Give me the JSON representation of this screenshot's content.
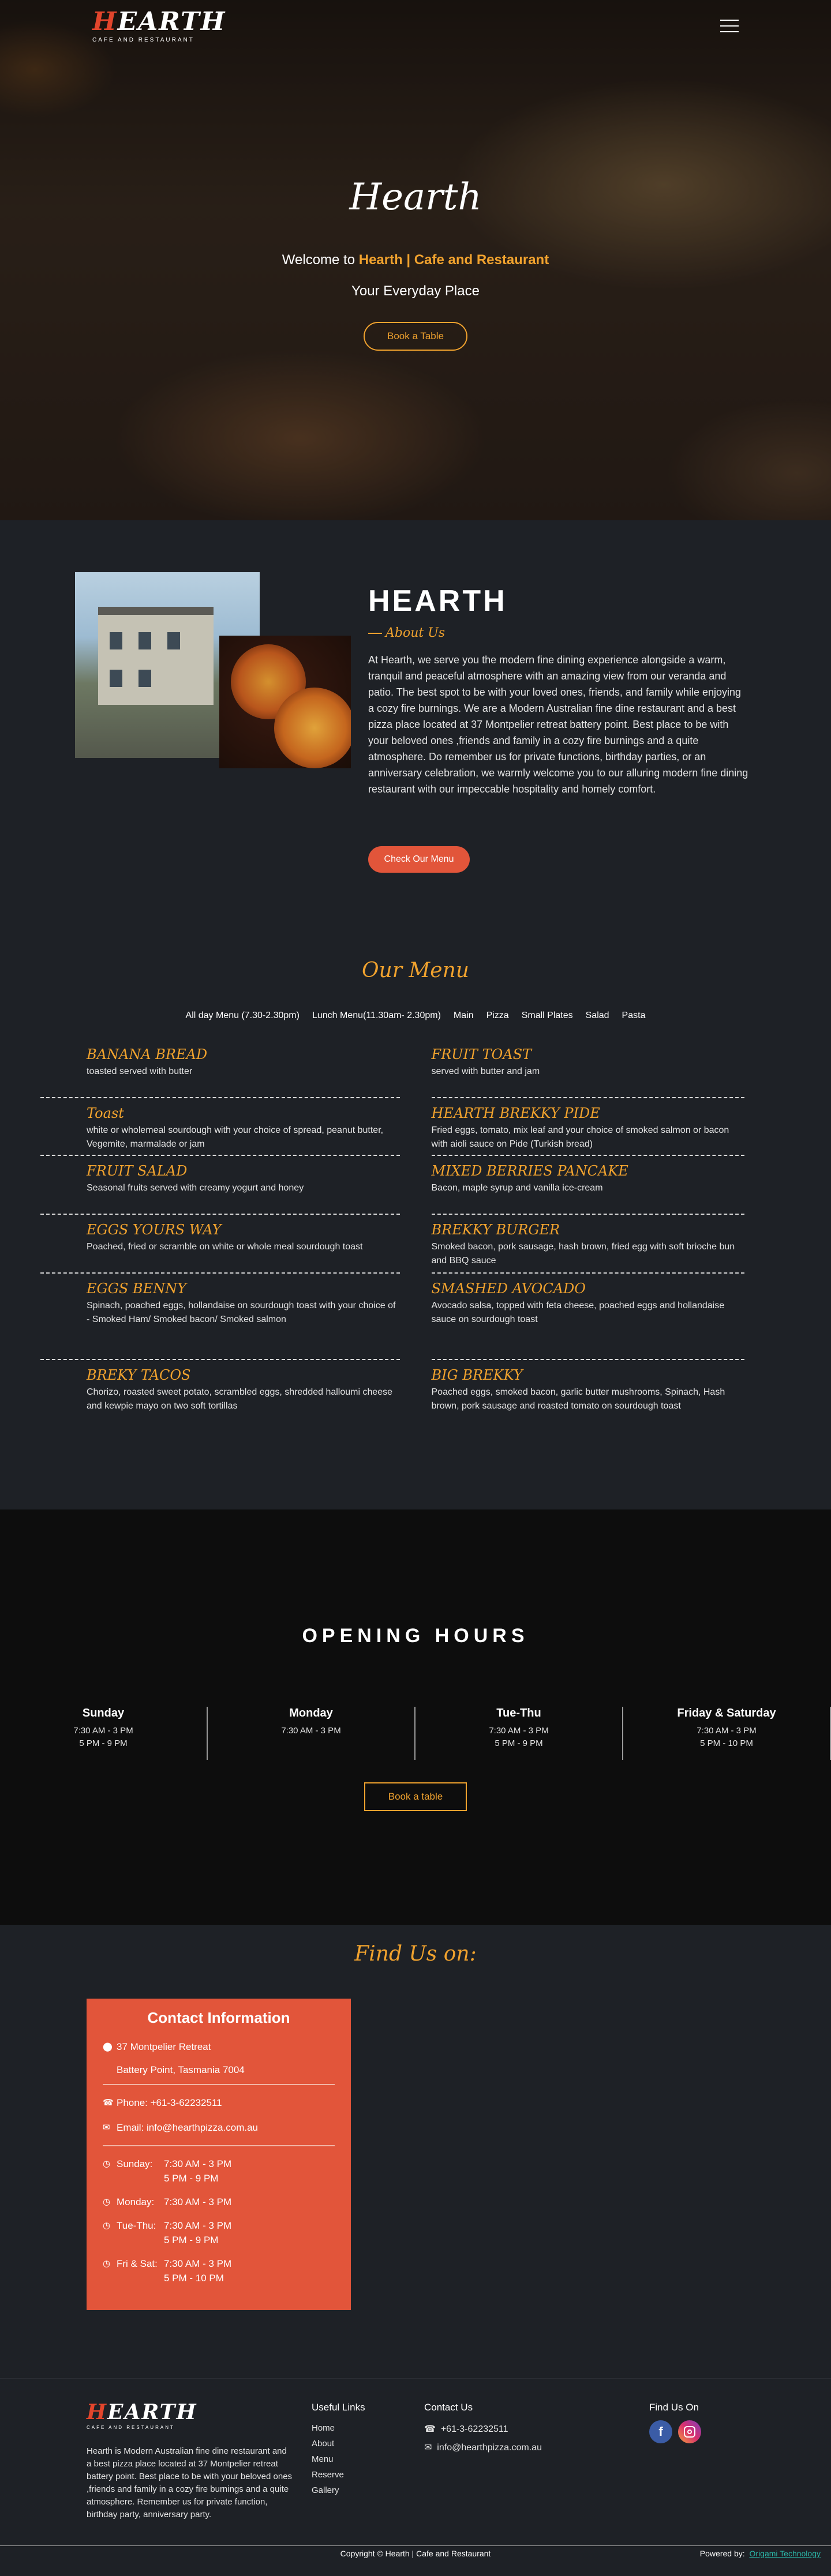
{
  "brand": {
    "logo_word": "HEARTH",
    "logo_sub": "CAFE AND RESTAURANT"
  },
  "hero": {
    "title": "Hearth",
    "welcome_prefix": "Welcome to ",
    "welcome_accent": "Hearth | Cafe and Restaurant",
    "tagline": "Your Everyday Place",
    "button": "Book a Table"
  },
  "about": {
    "title": "HEARTH",
    "subtitle": "About Us",
    "text": "At Hearth, we serve you the modern fine dining experience alongside a warm, tranquil and peaceful atmosphere with an amazing view from our veranda and patio. The best spot to be with your loved ones, friends, and family while enjoying a cozy fire burnings. We are a Modern Australian fine dine restaurant and a best pizza place located at 37 Montpelier retreat battery point. Best place to be with your beloved ones ,friends and family in a cozy fire burnings and a quite atmosphere. Do remember us for private functions, birthday parties, or an anniversary celebration, we warmly welcome you to our alluring modern fine dining restaurant with our impeccable hospitality and homely comfort.",
    "button": "Check Our Menu"
  },
  "menu": {
    "heading": "Our Menu",
    "tabs": [
      "All day Menu (7.30-2.30pm)",
      "Lunch Menu(11.30am- 2.30pm)",
      "Main",
      "Pizza",
      "Small Plates",
      "Salad",
      "Pasta"
    ],
    "left": [
      {
        "name": "BANANA BREAD",
        "desc": "toasted served with butter"
      },
      {
        "name": "Toast",
        "desc": "white or wholemeal sourdough with your choice of spread, peanut butter, Vegemite, marmalade or jam"
      },
      {
        "name": "FRUIT SALAD",
        "desc": "Seasonal fruits served with creamy yogurt and honey"
      },
      {
        "name": "EGGS YOURS WAY",
        "desc": "Poached, fried or scramble on white or whole meal sourdough toast"
      },
      {
        "name": "EGGS BENNY",
        "desc": "Spinach, poached eggs, hollandaise on sourdough toast with your choice of - Smoked Ham/ Smoked bacon/ Smoked salmon"
      },
      {
        "name": "BREKY TACOS",
        "desc": "Chorizo, roasted sweet potato, scrambled eggs, shredded halloumi cheese and kewpie mayo on two soft tortillas"
      }
    ],
    "right": [
      {
        "name": "FRUIT TOAST",
        "desc": "served with butter and jam"
      },
      {
        "name": "HEARTH BREKKY PIDE",
        "desc": "Fried eggs, tomato, mix leaf and your choice of smoked salmon or bacon with aioli sauce on Pide (Turkish bread)"
      },
      {
        "name": "MIXED BERRIES PANCAKE",
        "desc": "Bacon, maple syrup and vanilla ice-cream"
      },
      {
        "name": "BREKKY BURGER",
        "desc": "Smoked bacon, pork sausage, hash brown, fried egg with soft brioche bun and BBQ sauce"
      },
      {
        "name": "SMASHED AVOCADO",
        "desc": "Avocado salsa, topped with feta cheese, poached eggs and hollandaise sauce on sourdough toast"
      },
      {
        "name": "BIG BREKKY",
        "desc": "Poached eggs, smoked bacon, garlic butter mushrooms, Spinach, Hash brown, pork sausage and roasted tomato on sourdough toast"
      }
    ]
  },
  "hours": {
    "title": "OPENING HOURS",
    "days": [
      {
        "day": "Sunday",
        "line1": "7:30 AM - 3 PM",
        "line2": "5 PM - 9 PM"
      },
      {
        "day": "Monday",
        "line1": "7:30 AM - 3 PM",
        "line2": ""
      },
      {
        "day": "Tue-Thu",
        "line1": "7:30 AM - 3 PM",
        "line2": "5 PM - 9 PM"
      },
      {
        "day": "Friday & Saturday",
        "line1": "7:30 AM - 3 PM",
        "line2": "5 PM - 10 PM"
      }
    ],
    "button": "Book a table"
  },
  "findus": {
    "title": "Find Us on:",
    "card_title": "Contact Information",
    "address1": "37 Montpelier Retreat",
    "address2": "Battery Point, Tasmania 7004",
    "phone": "Phone: +61-3-62232511",
    "email": "Email: info@hearthpizza.com.au",
    "hours": [
      {
        "day": "Sunday:",
        "line1": "7:30 AM - 3 PM",
        "line2": "5 PM - 9 PM"
      },
      {
        "day": "Monday:",
        "line1": "7:30 AM - 3 PM",
        "line2": ""
      },
      {
        "day": "Tue-Thu:",
        "line1": "7:30 AM - 3 PM",
        "line2": "5 PM - 9 PM"
      },
      {
        "day": "Fri & Sat:",
        "line1": "7:30 AM - 3 PM",
        "line2": "5 PM - 10 PM"
      }
    ]
  },
  "footer": {
    "about": "Hearth is Modern Australian fine dine restaurant and a best pizza place located at 37 Montpelier retreat battery point. Best place to be with your beloved ones ,friends and family in a cozy fire burnings and a quite atmosphere. Remember us for private function, birthday party, anniversary party.",
    "links_head": "Useful Links",
    "links": [
      "Home",
      "About",
      "Menu",
      "Reserve",
      "Gallery"
    ],
    "contact_head": "Contact Us",
    "phone": "+61-3-62232511",
    "email": "info@hearthpizza.com.au",
    "find_head": "Find Us On",
    "facebook_letter": "f",
    "copyright": "Copyright © Hearth | Cafe and Restaurant",
    "powered_prefix": "Powered by:",
    "powered_brand": "Origami Technology"
  },
  "icons": {
    "location": "location-icon",
    "phone": "phone-icon",
    "email": "envelope-icon",
    "clock": "clock-icon",
    "facebook": "facebook-icon",
    "instagram": "instagram-icon"
  },
  "colors": {
    "accent": "#f0a22e",
    "brand_red": "#e2553a",
    "dark_bg": "#1e2126",
    "hours_bg": "#0d0d0d"
  }
}
